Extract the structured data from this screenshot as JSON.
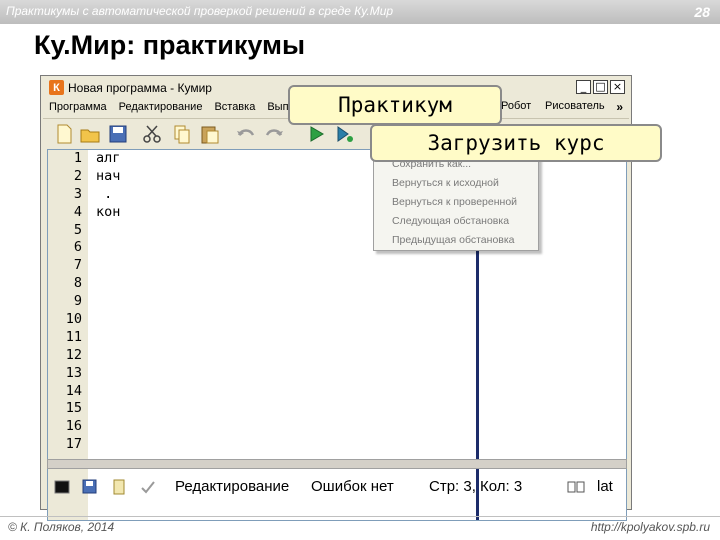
{
  "slide": {
    "header": "Практикумы с автоматической проверкой решений в среде Ку.Мир",
    "page_number": "28",
    "title": "Ку.Мир: практикумы",
    "footer_left": "© К. Поляков, 2014",
    "footer_right": "http://kpolyakov.spb.ru"
  },
  "window": {
    "logo": "К",
    "title": "Новая программа - Кумир",
    "buttons": {
      "minimize": "_",
      "maximize": "□",
      "close": "×"
    }
  },
  "menu": {
    "items": [
      "Программа",
      "Редактирование",
      "Вставка",
      "Вып"
    ],
    "robot": "Робот",
    "drawer": "Рисователь",
    "more": "»"
  },
  "toolbar": {
    "icons": [
      "new-file-icon",
      "open-folder-icon",
      "save-icon",
      "cut-icon",
      "copy-icon",
      "paste-icon",
      "undo-icon",
      "redo-icon",
      "run-icon",
      "run-step-icon"
    ]
  },
  "editor": {
    "line_numbers": [
      "1",
      "2",
      "3",
      "4",
      "5",
      "6",
      "7",
      "8",
      "9",
      "10",
      "11",
      "12",
      "13",
      "14",
      "15",
      "16",
      "17"
    ],
    "code_lines": [
      "алг",
      "нач",
      " .",
      "кон"
    ]
  },
  "dropdown": {
    "items": [
      "Сохранить как...",
      "Вернуться к исходной",
      "Вернуться к проверенной",
      "Следующая обстановка",
      "Предыдущая обстановка"
    ]
  },
  "callouts": {
    "practicum": "Практикум",
    "load_course": "Загрузить курс"
  },
  "status": {
    "mode": "Редактирование",
    "errors": "Ошибок нет",
    "position": "Стр: 3, Кол: 3",
    "layout": "lat"
  },
  "colors": {
    "window_bg": "#ece9d8",
    "callout_bg": "#fffbc7",
    "divider": "#1c2c6a",
    "logo": "#e8741b"
  }
}
